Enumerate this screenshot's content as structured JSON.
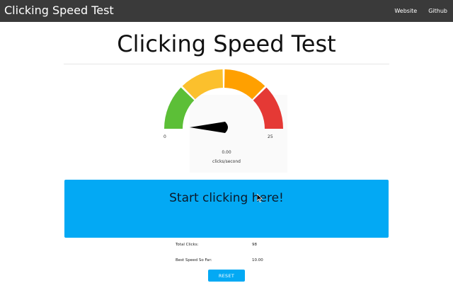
{
  "navbar": {
    "brand": "Clicking Speed Test",
    "links": [
      "Website",
      "Github"
    ]
  },
  "page": {
    "title": "Clicking Speed Test"
  },
  "gauge": {
    "min_label": "0",
    "max_label": "25",
    "value": 0,
    "value_text": "0.00",
    "unit": "clicks/second",
    "segment_colors": [
      "#5cbf37",
      "#fbc02d",
      "#ffa000",
      "#e53935"
    ],
    "needle_color": "#000000"
  },
  "click_area": {
    "label": "Start clicking here!",
    "color": "#03a9f4"
  },
  "stats": {
    "total_clicks_label": "Total Clicks:",
    "total_clicks_value": "98",
    "best_speed_label": "Best Speed So Far:",
    "best_speed_value": "10.00"
  },
  "reset_button": {
    "label": "RESET"
  }
}
